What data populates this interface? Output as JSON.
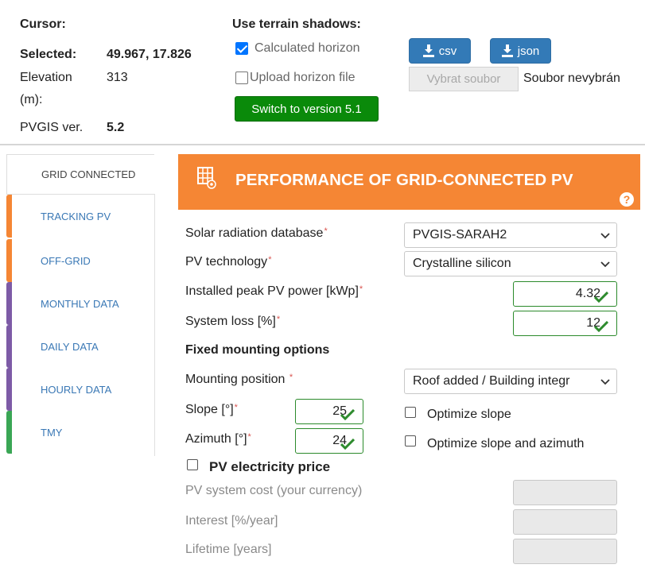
{
  "top": {
    "cursor_label": "Cursor:",
    "selected_label": "Selected:",
    "selected_value": "49.967, 17.826",
    "elevation_label_1": "Elevation",
    "elevation_label_2": "(m):",
    "elevation_value": "313",
    "pvgis_label": "PVGIS ver.",
    "pvgis_value": "5.2",
    "terrain_title": "Use terrain shadows:",
    "calculated_horizon": "Calculated horizon",
    "calculated_horizon_checked": true,
    "upload_horizon": "Upload horizon file",
    "upload_horizon_checked": false,
    "switch_button": "Switch to version 5.1",
    "csv_button": "csv",
    "json_button": "json",
    "choose_file_button": "Vybrat soubor",
    "no_file_text": "Soubor nevybrán"
  },
  "tabs": [
    {
      "label": "GRID CONNECTED",
      "active": true,
      "color": ""
    },
    {
      "label": "TRACKING PV",
      "active": false,
      "color": "#f58634"
    },
    {
      "label": "OFF-GRID",
      "active": false,
      "color": "#f58634"
    },
    {
      "label": "MONTHLY DATA",
      "active": false,
      "color": "#7d5ba6"
    },
    {
      "label": "DAILY DATA",
      "active": false,
      "color": "#7d5ba6"
    },
    {
      "label": "HOURLY DATA",
      "active": false,
      "color": "#7d5ba6"
    },
    {
      "label": "TMY",
      "active": false,
      "color": "#3aa655"
    }
  ],
  "header": {
    "title": "PERFORMANCE OF GRID-CONNECTED PV",
    "help": "?",
    "color": "#f58634"
  },
  "form": {
    "solar_db_label": "Solar radiation database",
    "solar_db_value": "PVGIS-SARAH2",
    "pv_tech_label": "PV technology",
    "pv_tech_value": "Crystalline silicon",
    "peak_power_label": "Installed peak PV power [kWp]",
    "peak_power_value": "4.32",
    "system_loss_label": "System loss [%]",
    "system_loss_value": "12",
    "fixed_mounting_title": "Fixed mounting options",
    "mounting_position_label": "Mounting position",
    "mounting_position_value": "Roof added / Building integr",
    "slope_label": "Slope [°]",
    "slope_value": "25",
    "azimuth_label": "Azimuth [°]",
    "azimuth_value": "24",
    "optimize_slope": "Optimize slope",
    "optimize_slope_azimuth": "Optimize slope and azimuth",
    "required_mark": "*"
  },
  "price": {
    "title": "PV electricity price",
    "system_cost_label": "PV system cost (your currency)",
    "interest_label": "Interest [%/year]",
    "lifetime_label": "Lifetime [years]"
  }
}
